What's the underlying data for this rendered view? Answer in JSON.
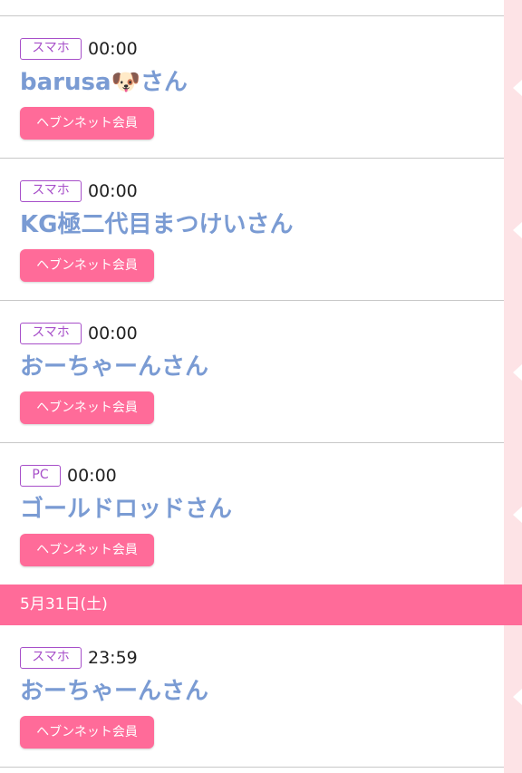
{
  "entries_before": [
    {
      "device": "スマホ",
      "time": "00:00",
      "name": "barusa",
      "emoji": "🐶",
      "suffix": "さん",
      "member": "ヘブンネット会員"
    },
    {
      "device": "スマホ",
      "time": "00:00",
      "name": "KG極二代目まつけい",
      "suffix": "さん",
      "member": "ヘブンネット会員"
    },
    {
      "device": "スマホ",
      "time": "00:00",
      "name": "おーちゃーん",
      "suffix": "さん",
      "member": "ヘブンネット会員"
    },
    {
      "device": "PC",
      "time": "00:00",
      "name": "ゴールドロッド",
      "suffix": "さん",
      "member": "ヘブンネット会員"
    }
  ],
  "date_header": "5月31日(土)",
  "entries_after": [
    {
      "device": "スマホ",
      "time": "23:59",
      "name": "おーちゃーん",
      "suffix": "さん",
      "member": "ヘブンネット会員"
    }
  ],
  "colors": {
    "accent_pink": "#ff6b99",
    "badge_purple": "#a74fc9",
    "name_blue": "#7a9bd3",
    "sidebar_pink": "#fde3e6"
  }
}
